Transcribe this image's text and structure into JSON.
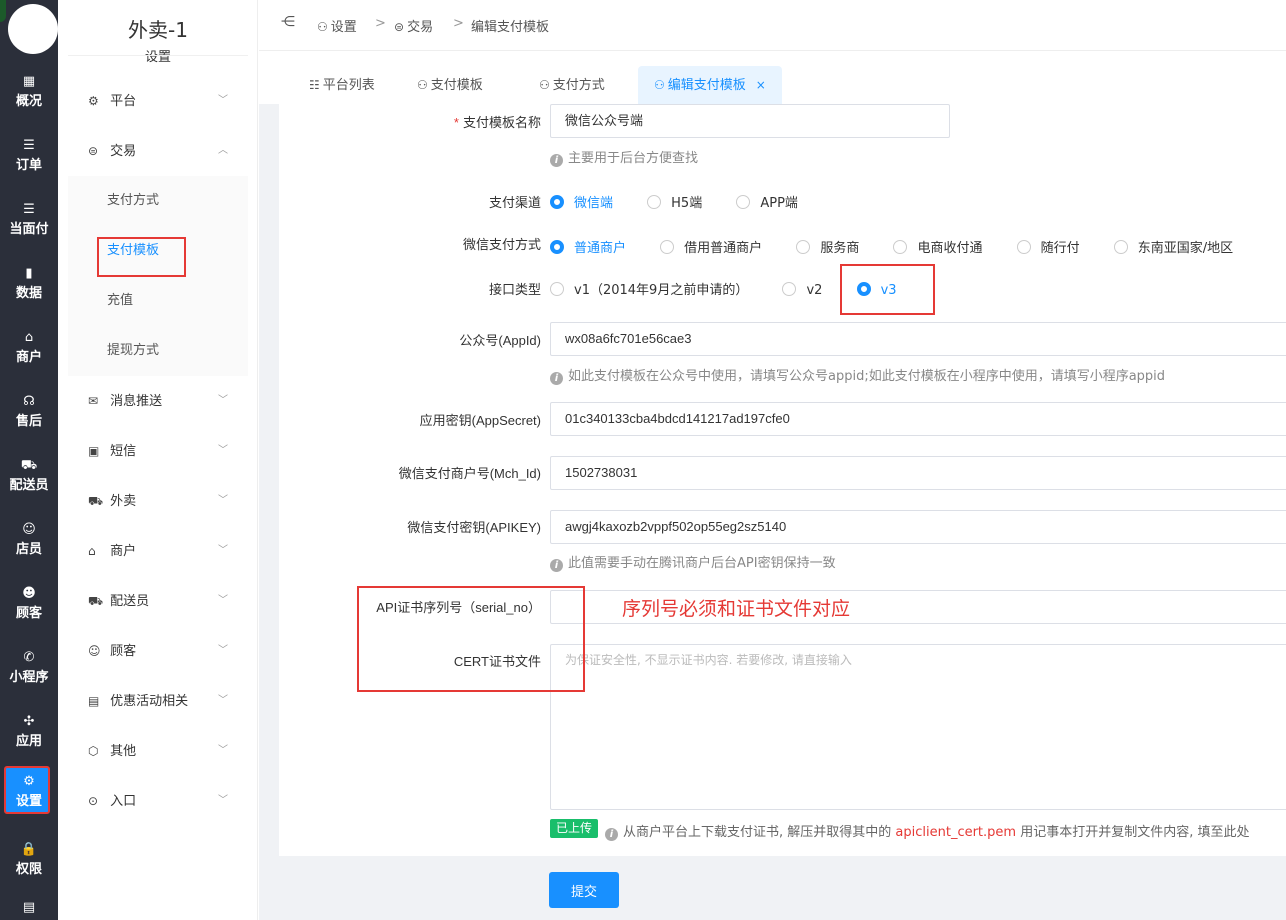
{
  "rail": {
    "items": [
      {
        "icon": "grid-icon",
        "glyph": "▦",
        "label": "概况"
      },
      {
        "icon": "list-icon",
        "glyph": "☰",
        "label": "订单"
      },
      {
        "icon": "list-icon",
        "glyph": "☰",
        "label": "当面付"
      },
      {
        "icon": "bar-chart-icon",
        "glyph": "▮",
        "label": "数据"
      },
      {
        "icon": "shop-icon",
        "glyph": "⌂",
        "label": "商户"
      },
      {
        "icon": "headset-icon",
        "glyph": "☊",
        "label": "售后"
      },
      {
        "icon": "scooter-icon",
        "glyph": "⛟",
        "label": "配送员"
      },
      {
        "icon": "people-icon",
        "glyph": "☺",
        "label": "店员"
      },
      {
        "icon": "user-circle-icon",
        "glyph": "☻",
        "label": "顾客"
      },
      {
        "icon": "wechat-icon",
        "glyph": "✆",
        "label": "小程序"
      },
      {
        "icon": "apps-icon",
        "glyph": "✣",
        "label": "应用"
      },
      {
        "icon": "settings-user-icon",
        "glyph": "⚙",
        "label": "设置"
      },
      {
        "icon": "lock-icon",
        "glyph": "🔒",
        "label": "权限"
      }
    ]
  },
  "sidebar": {
    "title": "外卖-1",
    "subtitle": "设置",
    "items": [
      {
        "icon": "gear-icon",
        "glyph": "⚙",
        "label": "平台",
        "chevron": "﹀"
      },
      {
        "icon": "trade-icon",
        "glyph": "⊜",
        "label": "交易",
        "chevron": "︿"
      },
      {
        "icon": "message-icon",
        "glyph": "✉",
        "label": "消息推送",
        "chevron": "﹀"
      },
      {
        "icon": "sms-icon",
        "glyph": "▣",
        "label": "短信",
        "chevron": "﹀"
      },
      {
        "icon": "delivery-icon",
        "glyph": "⛟",
        "label": "外卖",
        "chevron": "﹀"
      },
      {
        "icon": "shop-icon",
        "glyph": "⌂",
        "label": "商户",
        "chevron": "﹀"
      },
      {
        "icon": "rider-icon",
        "glyph": "⛟",
        "label": "配送员",
        "chevron": "﹀"
      },
      {
        "icon": "user-circle-icon",
        "glyph": "☺",
        "label": "顾客",
        "chevron": "﹀"
      },
      {
        "icon": "gift-icon",
        "glyph": "▤",
        "label": "优惠活动相关",
        "chevron": "﹀"
      },
      {
        "icon": "hexagon-icon",
        "glyph": "⬡",
        "label": "其他",
        "chevron": "﹀"
      },
      {
        "icon": "compass-icon",
        "glyph": "⊙",
        "label": "入口",
        "chevron": "﹀"
      }
    ],
    "sub_items": [
      "支付方式",
      "支付模板",
      "充值",
      "提现方式"
    ]
  },
  "header": {
    "fold_glyph": "⋲",
    "breadcrumb": [
      "设置",
      "交易",
      "编辑支付模板"
    ],
    "separator": ">"
  },
  "tabs": [
    {
      "label": "平台列表",
      "icon": "list-icon",
      "glyph": "☷"
    },
    {
      "label": "支付模板",
      "icon": "user-icon",
      "glyph": "⚇"
    },
    {
      "label": "支付方式",
      "icon": "user-icon",
      "glyph": "⚇"
    },
    {
      "label": "编辑支付模板",
      "icon": "user-icon",
      "glyph": "⚇",
      "close": "×"
    }
  ],
  "form": {
    "name_label": "支付模板名称",
    "name_value": "微信公众号端",
    "name_hint": "主要用于后台方便查找",
    "channel_label": "支付渠道",
    "channel_options": [
      "微信端",
      "H5端",
      "APP端"
    ],
    "channel_selected": 0,
    "method_label": "微信支付方式",
    "method_options": [
      "普通商户",
      "借用普通商户",
      "服务商",
      "电商收付通",
      "随行付",
      "东南亚国家/地区"
    ],
    "method_selected": 0,
    "api_label": "接口类型",
    "api_options": [
      "v1（2014年9月之前申请的）",
      "v2",
      "v3"
    ],
    "api_selected": 2,
    "appid_label": "公众号(AppId)",
    "appid_value": "wx08a6fc701e56cae3",
    "appid_hint": "如此支付模板在公众号中使用，请填写公众号appid;如此支付模板在小程序中使用，请填写小程序appid",
    "secret_label": "应用密钥(AppSecret)",
    "secret_value": "01c340133cba4bdcd141217ad197cfe0",
    "mchid_label": "微信支付商户号(Mch_Id)",
    "mchid_value": "1502738031",
    "apikey_label": "微信支付密钥(APIKEY)",
    "apikey_value": "awgj4kaxozb2vppf502op55eg2sz5140",
    "apikey_hint": "此值需要手动在腾讯商户后台API密钥保持一致",
    "serial_label": "API证书序列号（serial_no）",
    "serial_value": "",
    "annotation": "序列号必须和证书文件对应",
    "cert_label": "CERT证书文件",
    "cert_placeholder": "为保证安全性, 不显示证书内容. 若要修改, 请直接输入",
    "uploaded_badge": "已上传",
    "cert_hint_before": "从商户平台上下载支付证书, 解压并取得其中的 ",
    "cert_hint_file": "apiclient_cert.pem",
    "cert_hint_after": " 用记事本打开并复制文件内容, 填至此处",
    "submit_label": "提交",
    "hint_glyph": "i"
  },
  "colors": {
    "accent": "#1890ff",
    "annotation_red": "#e53935",
    "rail_bg": "#2b2f3a",
    "success": "#19be6b"
  }
}
